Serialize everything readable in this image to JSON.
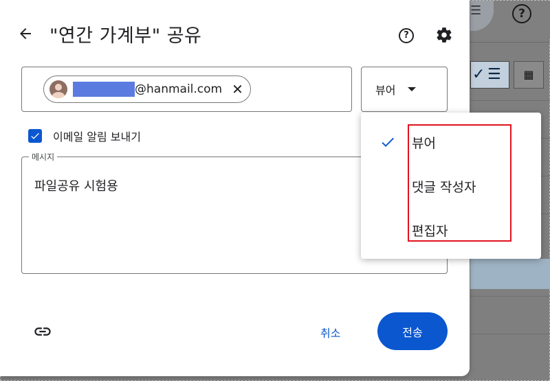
{
  "background": {
    "help_glyph": "?",
    "menu_glyph": "☰",
    "grid_glyph": "▦"
  },
  "dialog": {
    "title": "\"연간 가계부\" 공유",
    "recipient": {
      "email_domain": "@hanmail.com"
    },
    "role_selected": "뷰어",
    "notify_label": "이메일 알림 보내기",
    "notify_checked": true,
    "message_legend": "메시지",
    "message_text": "파일공유 시험용",
    "cancel_label": "취소",
    "send_label": "전송"
  },
  "role_menu": {
    "items": [
      {
        "label": "뷰어",
        "selected": true
      },
      {
        "label": "댓글 작성자",
        "selected": false
      },
      {
        "label": "편집자",
        "selected": false
      }
    ]
  },
  "colors": {
    "accent": "#0b57d0",
    "highlight": "#e0121d"
  }
}
